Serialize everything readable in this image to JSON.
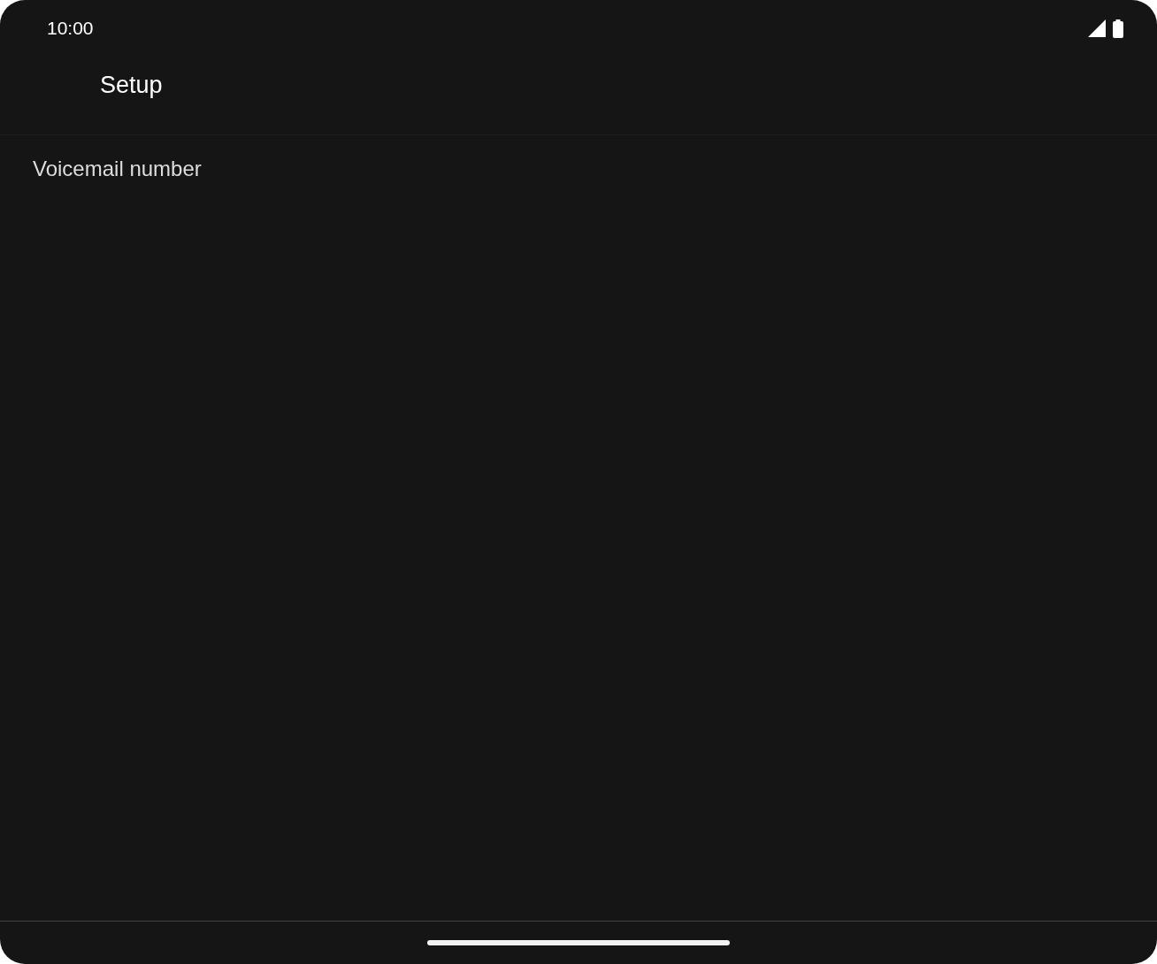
{
  "status_bar": {
    "time": "10:00"
  },
  "app_bar": {
    "title": "Setup"
  },
  "preferences": [
    {
      "title": "Voicemail number"
    }
  ]
}
